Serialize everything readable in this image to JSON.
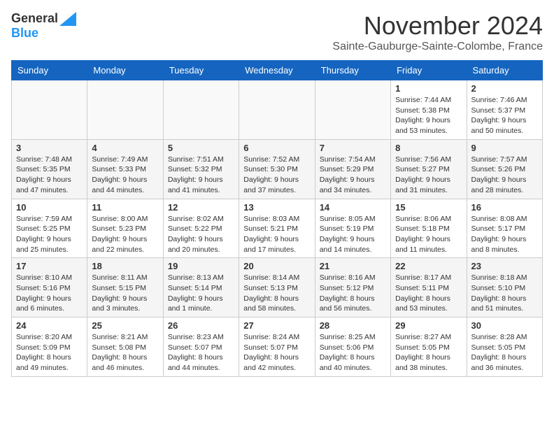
{
  "header": {
    "logo_general": "General",
    "logo_blue": "Blue",
    "month": "November 2024",
    "location": "Sainte-Gauburge-Sainte-Colombe, France"
  },
  "days_of_week": [
    "Sunday",
    "Monday",
    "Tuesday",
    "Wednesday",
    "Thursday",
    "Friday",
    "Saturday"
  ],
  "weeks": [
    [
      {
        "day": "",
        "info": ""
      },
      {
        "day": "",
        "info": ""
      },
      {
        "day": "",
        "info": ""
      },
      {
        "day": "",
        "info": ""
      },
      {
        "day": "",
        "info": ""
      },
      {
        "day": "1",
        "info": "Sunrise: 7:44 AM\nSunset: 5:38 PM\nDaylight: 9 hours and 53 minutes."
      },
      {
        "day": "2",
        "info": "Sunrise: 7:46 AM\nSunset: 5:37 PM\nDaylight: 9 hours and 50 minutes."
      }
    ],
    [
      {
        "day": "3",
        "info": "Sunrise: 7:48 AM\nSunset: 5:35 PM\nDaylight: 9 hours and 47 minutes."
      },
      {
        "day": "4",
        "info": "Sunrise: 7:49 AM\nSunset: 5:33 PM\nDaylight: 9 hours and 44 minutes."
      },
      {
        "day": "5",
        "info": "Sunrise: 7:51 AM\nSunset: 5:32 PM\nDaylight: 9 hours and 41 minutes."
      },
      {
        "day": "6",
        "info": "Sunrise: 7:52 AM\nSunset: 5:30 PM\nDaylight: 9 hours and 37 minutes."
      },
      {
        "day": "7",
        "info": "Sunrise: 7:54 AM\nSunset: 5:29 PM\nDaylight: 9 hours and 34 minutes."
      },
      {
        "day": "8",
        "info": "Sunrise: 7:56 AM\nSunset: 5:27 PM\nDaylight: 9 hours and 31 minutes."
      },
      {
        "day": "9",
        "info": "Sunrise: 7:57 AM\nSunset: 5:26 PM\nDaylight: 9 hours and 28 minutes."
      }
    ],
    [
      {
        "day": "10",
        "info": "Sunrise: 7:59 AM\nSunset: 5:25 PM\nDaylight: 9 hours and 25 minutes."
      },
      {
        "day": "11",
        "info": "Sunrise: 8:00 AM\nSunset: 5:23 PM\nDaylight: 9 hours and 22 minutes."
      },
      {
        "day": "12",
        "info": "Sunrise: 8:02 AM\nSunset: 5:22 PM\nDaylight: 9 hours and 20 minutes."
      },
      {
        "day": "13",
        "info": "Sunrise: 8:03 AM\nSunset: 5:21 PM\nDaylight: 9 hours and 17 minutes."
      },
      {
        "day": "14",
        "info": "Sunrise: 8:05 AM\nSunset: 5:19 PM\nDaylight: 9 hours and 14 minutes."
      },
      {
        "day": "15",
        "info": "Sunrise: 8:06 AM\nSunset: 5:18 PM\nDaylight: 9 hours and 11 minutes."
      },
      {
        "day": "16",
        "info": "Sunrise: 8:08 AM\nSunset: 5:17 PM\nDaylight: 9 hours and 8 minutes."
      }
    ],
    [
      {
        "day": "17",
        "info": "Sunrise: 8:10 AM\nSunset: 5:16 PM\nDaylight: 9 hours and 6 minutes."
      },
      {
        "day": "18",
        "info": "Sunrise: 8:11 AM\nSunset: 5:15 PM\nDaylight: 9 hours and 3 minutes."
      },
      {
        "day": "19",
        "info": "Sunrise: 8:13 AM\nSunset: 5:14 PM\nDaylight: 9 hours and 1 minute."
      },
      {
        "day": "20",
        "info": "Sunrise: 8:14 AM\nSunset: 5:13 PM\nDaylight: 8 hours and 58 minutes."
      },
      {
        "day": "21",
        "info": "Sunrise: 8:16 AM\nSunset: 5:12 PM\nDaylight: 8 hours and 56 minutes."
      },
      {
        "day": "22",
        "info": "Sunrise: 8:17 AM\nSunset: 5:11 PM\nDaylight: 8 hours and 53 minutes."
      },
      {
        "day": "23",
        "info": "Sunrise: 8:18 AM\nSunset: 5:10 PM\nDaylight: 8 hours and 51 minutes."
      }
    ],
    [
      {
        "day": "24",
        "info": "Sunrise: 8:20 AM\nSunset: 5:09 PM\nDaylight: 8 hours and 49 minutes."
      },
      {
        "day": "25",
        "info": "Sunrise: 8:21 AM\nSunset: 5:08 PM\nDaylight: 8 hours and 46 minutes."
      },
      {
        "day": "26",
        "info": "Sunrise: 8:23 AM\nSunset: 5:07 PM\nDaylight: 8 hours and 44 minutes."
      },
      {
        "day": "27",
        "info": "Sunrise: 8:24 AM\nSunset: 5:07 PM\nDaylight: 8 hours and 42 minutes."
      },
      {
        "day": "28",
        "info": "Sunrise: 8:25 AM\nSunset: 5:06 PM\nDaylight: 8 hours and 40 minutes."
      },
      {
        "day": "29",
        "info": "Sunrise: 8:27 AM\nSunset: 5:05 PM\nDaylight: 8 hours and 38 minutes."
      },
      {
        "day": "30",
        "info": "Sunrise: 8:28 AM\nSunset: 5:05 PM\nDaylight: 8 hours and 36 minutes."
      }
    ]
  ]
}
